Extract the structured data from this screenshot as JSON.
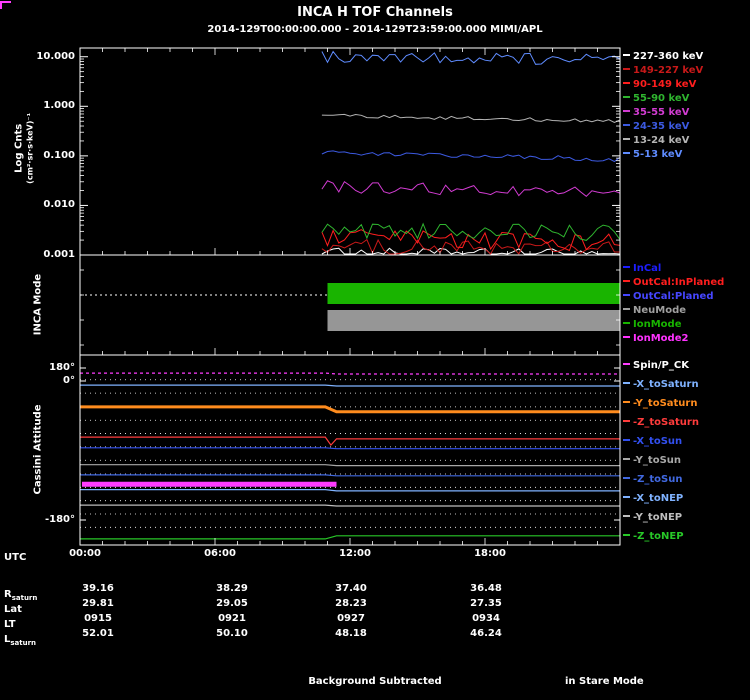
{
  "title": "INCA H TOF Channels",
  "subtitle": "2014-129T00:00:00.000 - 2014-129T23:59:00.000 MIMI/APL",
  "footer": {
    "left": "Background Subtracted",
    "right": "in Stare Mode"
  },
  "xaxis": {
    "label": "UTC",
    "ticks": [
      "00:00",
      "06:00",
      "12:00",
      "18:00"
    ]
  },
  "flux_panel": {
    "ylabel_line1": "Log Cnts",
    "ylabel_line2": "(cm²·sr·s·keV)⁻¹",
    "yticks": [
      "10.000",
      "1.000",
      "0.100",
      "0.010",
      "0.001"
    ]
  },
  "mode_panel": {
    "ylabel": "INCA Mode"
  },
  "attitude_panel": {
    "ylabel": "Cassini Attitude",
    "yticks": [
      "180°",
      "0°",
      "-180°"
    ]
  },
  "ephemeris": {
    "rows": [
      {
        "label": "R",
        "sub": "saturn",
        "values": [
          "39.16",
          "38.29",
          "37.40",
          "36.48"
        ]
      },
      {
        "label": "Lat",
        "sub": "",
        "values": [
          "29.81",
          "29.05",
          "28.23",
          "27.35"
        ]
      },
      {
        "label": "LT",
        "sub": "",
        "values": [
          "0915",
          "0921",
          "0927",
          "0934"
        ]
      },
      {
        "label": "L",
        "sub": "saturn",
        "values": [
          "52.01",
          "50.10",
          "48.18",
          "46.24"
        ]
      }
    ]
  },
  "chart_data": [
    {
      "type": "line",
      "title": "INCA H TOF Channels — differential flux",
      "ylabel": "Log Cnts (cm²·sr·s·keV)⁻¹",
      "xlabel": "UTC 2014-129",
      "xlim_hours": [
        0,
        24
      ],
      "ylog": true,
      "ylim": [
        0.001,
        15
      ],
      "ytick_values": [
        10,
        1,
        0.1,
        0.01,
        0.001
      ],
      "data_start_hour": 10.75,
      "legend_position": "right",
      "series": [
        {
          "name": "227-360 keV",
          "color": "#FFFFFF",
          "level_start": 0.0011,
          "level_end": 0.00105,
          "noise_log10": 0.1
        },
        {
          "name": "149-227 keV",
          "color": "#C81919",
          "level_start": 0.0015,
          "level_end": 0.0013,
          "noise_log10": 0.15
        },
        {
          "name": "90-149 keV",
          "color": "#FF1E1E",
          "level_start": 0.0022,
          "level_end": 0.0018,
          "noise_log10": 0.18
        },
        {
          "name": "55-90 keV",
          "color": "#2FB52F",
          "level_start": 0.0032,
          "level_end": 0.0028,
          "noise_log10": 0.16
        },
        {
          "name": "35-55 keV",
          "color": "#D23CD2",
          "level_start": 0.024,
          "level_end": 0.018,
          "noise_log10": 0.13
        },
        {
          "name": "24-35 keV",
          "color": "#3C5AE1",
          "level_start": 0.12,
          "level_end": 0.085,
          "noise_log10": 0.05
        },
        {
          "name": "13-24 keV",
          "color": "#B4B4B4",
          "level_start": 0.65,
          "level_end": 0.5,
          "noise_log10": 0.035
        },
        {
          "name": "5-13 keV",
          "color": "#5F8CFF",
          "level_start": 10.0,
          "level_end": 8.5,
          "noise_log10": 0.12
        }
      ]
    },
    {
      "type": "interval",
      "title": "INCA Mode",
      "legend": [
        {
          "label": "InCal",
          "color": "#1E1EFF"
        },
        {
          "label": "OutCal:InPlaned",
          "color": "#FF1E1E"
        },
        {
          "label": "OutCal:Planed",
          "color": "#4646FF"
        },
        {
          "label": "NeuMode",
          "color": "#A0A0A0"
        },
        {
          "label": "IonMode",
          "color": "#19B400"
        },
        {
          "label": "IonMode2",
          "color": "#FF32FF"
        }
      ],
      "bars": [
        {
          "name": "IonMode",
          "color": "#19B400",
          "start_hour": 11.0,
          "end_hour": 24
        },
        {
          "name": "NeuMode",
          "color": "#969696",
          "start_hour": 11.0,
          "end_hour": 24
        }
      ],
      "pre_dotted_end_hour": 11.0
    },
    {
      "type": "line",
      "title": "Cassini Attitude",
      "ylim": [
        -200,
        200
      ],
      "ytick_labels": [
        "180°",
        "0°",
        "-180°"
      ],
      "transition": {
        "start_hour": 10.9,
        "end_hour": 11.4
      },
      "guide_levels_deg": [
        158,
        128,
        97,
        67,
        37,
        7,
        -23,
        -54,
        -84,
        -114,
        -144,
        -174
      ],
      "spin_phase": {
        "name": "Spin/P_CK",
        "color": "#FF3CFF",
        "level": -77,
        "start_hour": 0,
        "end_hour": 11.4
      },
      "series": [
        {
          "name": "Spin/P_CK",
          "color": "#FF3CFF",
          "legend_color": "#FFFFFF",
          "style": "dashed",
          "pre": 173,
          "post": 171
        },
        {
          "name": "-X_toSaturn",
          "color": "#7FB2FF",
          "style": "solid",
          "pre": 146,
          "post": 144
        },
        {
          "name": "-Y_toSaturn",
          "color": "#FF8C1E",
          "style": "thick",
          "pre": 97,
          "post": 86
        },
        {
          "name": "-Z_toSaturn",
          "color": "#FF3C3C",
          "style": "solid",
          "pre": 29,
          "post": 25,
          "dip": 11
        },
        {
          "name": "-X_toSun",
          "color": "#3250F0",
          "style": "solid",
          "pre": 5,
          "post": 3
        },
        {
          "name": "-Y_toSun",
          "color": "#A8A8A8",
          "style": "solid",
          "pre": -33,
          "post": -35
        },
        {
          "name": "-Z_toSun",
          "color": "#4169E1",
          "style": "solid",
          "pre": -56,
          "post": -58
        },
        {
          "name": "-X_toNEP",
          "color": "#7FB2FF",
          "style": "solid",
          "pre": -89,
          "post": -92
        },
        {
          "name": "-Y_toNEP",
          "color": "#BEBEBE",
          "style": "solid",
          "pre": -124,
          "post": -126
        },
        {
          "name": "-Z_toNEP",
          "color": "#28C828",
          "style": "solid",
          "pre": -200,
          "post": -193
        }
      ]
    }
  ]
}
